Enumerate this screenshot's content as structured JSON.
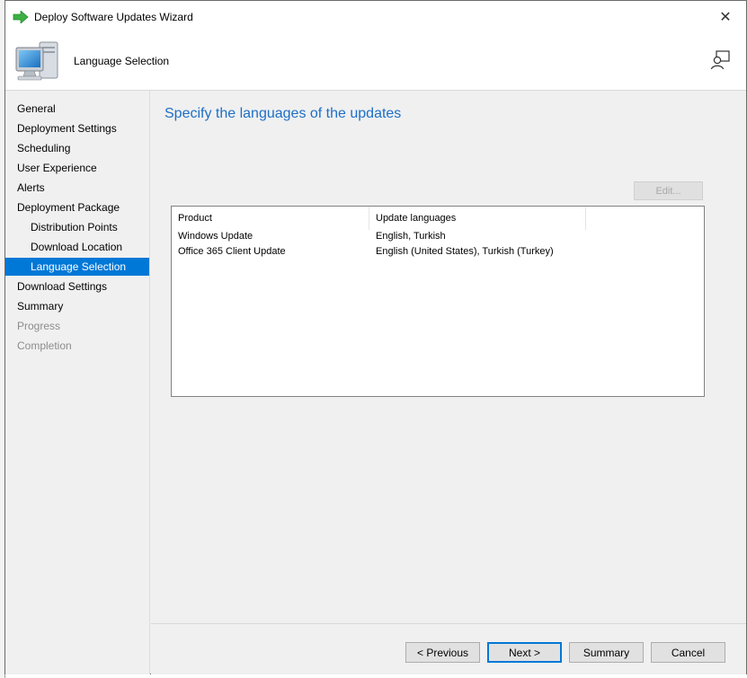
{
  "window": {
    "title": "Deploy Software Updates Wizard",
    "close_glyph": "✕"
  },
  "header": {
    "title": "Language Selection"
  },
  "nav": {
    "items": [
      {
        "label": "General",
        "level": "top",
        "state": "normal"
      },
      {
        "label": "Deployment Settings",
        "level": "top",
        "state": "normal"
      },
      {
        "label": "Scheduling",
        "level": "top",
        "state": "normal"
      },
      {
        "label": "User Experience",
        "level": "top",
        "state": "normal"
      },
      {
        "label": "Alerts",
        "level": "top",
        "state": "normal"
      },
      {
        "label": "Deployment Package",
        "level": "top",
        "state": "normal"
      },
      {
        "label": "Distribution Points",
        "level": "sub",
        "state": "normal"
      },
      {
        "label": "Download Location",
        "level": "sub",
        "state": "normal"
      },
      {
        "label": "Language Selection",
        "level": "sub",
        "state": "active"
      },
      {
        "label": "Download Settings",
        "level": "top",
        "state": "normal"
      },
      {
        "label": "Summary",
        "level": "top",
        "state": "normal"
      },
      {
        "label": "Progress",
        "level": "top",
        "state": "disabled"
      },
      {
        "label": "Completion",
        "level": "top",
        "state": "disabled"
      }
    ]
  },
  "main": {
    "heading": "Specify the languages of the updates",
    "edit_label": "Edit...",
    "table": {
      "columns": [
        "Product",
        "Update languages"
      ],
      "rows": [
        [
          "Windows Update",
          "English, Turkish"
        ],
        [
          "Office 365 Client Update",
          "English (United States), Turkish (Turkey)"
        ]
      ]
    }
  },
  "footer": {
    "previous_label": "< Previous",
    "next_label": "Next >",
    "summary_label": "Summary",
    "cancel_label": "Cancel"
  },
  "colors": {
    "accent": "#0078d7",
    "heading": "#1e6fc6",
    "disabled_text": "#8c8c8c"
  },
  "icons": {
    "title": "green-arrow-icon",
    "header": "computer-icon",
    "help": "help-person-icon"
  }
}
